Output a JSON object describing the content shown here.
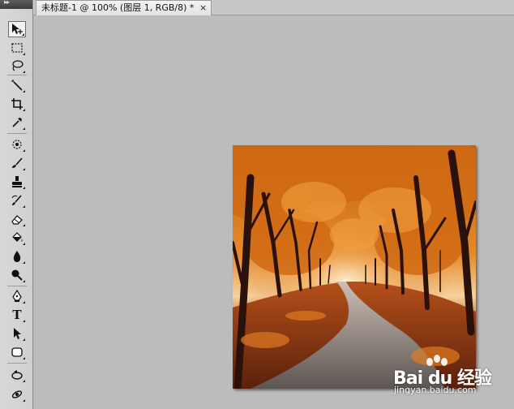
{
  "document_tab": {
    "title": "未标题-1 @ 100% (图层 1, RGB/8) *",
    "close_glyph": "×"
  },
  "toolbar": {
    "tools": [
      {
        "name": "move-tool",
        "icon": "move-icon"
      },
      {
        "name": "marquee-tool",
        "icon": "rectangular-marquee-icon"
      },
      {
        "name": "lasso-tool",
        "icon": "lasso-icon"
      },
      {
        "name": "magic-wand-tool",
        "icon": "magic-wand-icon"
      },
      {
        "name": "crop-tool",
        "icon": "crop-icon"
      },
      {
        "name": "eyedropper-tool",
        "icon": "eyedropper-icon"
      },
      {
        "name": "healing-brush-tool",
        "icon": "healing-brush-icon"
      },
      {
        "name": "brush-tool",
        "icon": "brush-icon"
      },
      {
        "name": "clone-stamp-tool",
        "icon": "stamp-icon"
      },
      {
        "name": "history-brush-tool",
        "icon": "history-brush-icon"
      },
      {
        "name": "eraser-tool",
        "icon": "eraser-icon"
      },
      {
        "name": "paint-bucket-tool",
        "icon": "paint-bucket-icon"
      },
      {
        "name": "blur-tool",
        "icon": "blur-drop-icon"
      },
      {
        "name": "dodge-tool",
        "icon": "dodge-icon"
      },
      {
        "name": "pen-tool",
        "icon": "pen-icon"
      },
      {
        "name": "type-tool",
        "icon": "type-icon",
        "label": "T"
      },
      {
        "name": "path-selection-tool",
        "icon": "path-selection-icon"
      },
      {
        "name": "shape-tool",
        "icon": "rounded-rectangle-icon"
      },
      {
        "name": "3d-rotate-tool",
        "icon": "3d-rotate-icon"
      },
      {
        "name": "3d-orbit-tool",
        "icon": "3d-orbit-icon"
      }
    ]
  },
  "colors": {
    "workspace": "#bcbcbc",
    "toolbar": "#d4d4d4",
    "tab_active": "#ececec",
    "foliage": "#d9771c",
    "road": "#7b7573"
  },
  "watermark": {
    "brand": "Bai du 经验",
    "url": "jingyan.baidu.com"
  }
}
